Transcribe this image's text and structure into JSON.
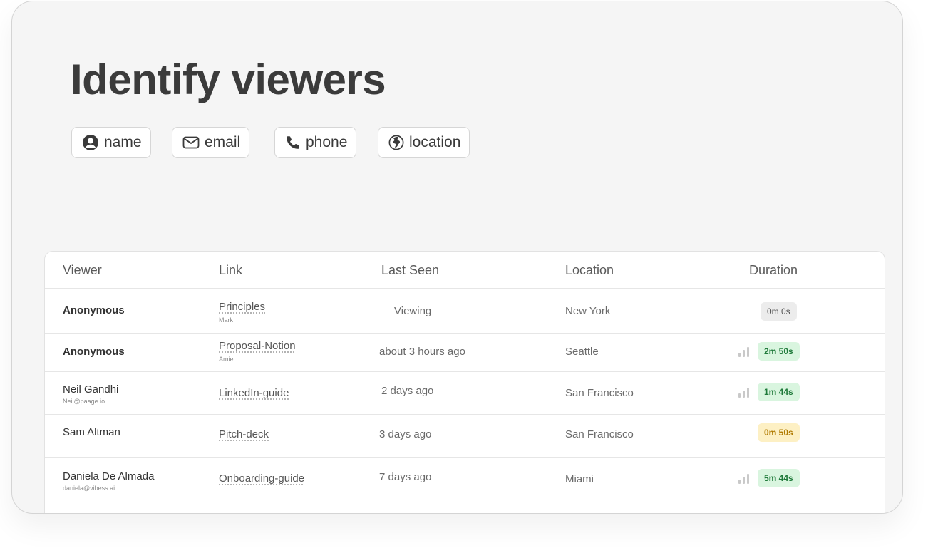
{
  "title": "Identify viewers",
  "chips": [
    {
      "label": "name",
      "icon": "user-circle-icon"
    },
    {
      "label": "email",
      "icon": "envelope-icon"
    },
    {
      "label": "phone",
      "icon": "phone-icon"
    },
    {
      "label": "location",
      "icon": "globe-icon"
    }
  ],
  "table": {
    "headers": {
      "viewer": "Viewer",
      "link": "Link",
      "last_seen": "Last Seen",
      "location": "Location",
      "duration": "Duration"
    },
    "rows": [
      {
        "viewer": "Anonymous",
        "viewer_sub": "",
        "link": "Principles",
        "link_sub": "Mark",
        "last_seen": "Viewing",
        "location": "New York",
        "duration": "0m 0s",
        "duration_style": "neutral",
        "bars_icon": false
      },
      {
        "viewer": "Anonymous",
        "viewer_sub": "",
        "link": "Proposal-Notion",
        "link_sub": "Amie",
        "last_seen": "about 3 hours ago",
        "location": "Seattle",
        "duration": "2m 50s",
        "duration_style": "green",
        "bars_icon": true
      },
      {
        "viewer": "Neil Gandhi",
        "viewer_sub": "Neil@paage.io",
        "link": "LinkedIn-guide",
        "link_sub": "",
        "last_seen": "2 days ago",
        "location": "San Francisco",
        "duration": "1m 44s",
        "duration_style": "green",
        "bars_icon": true
      },
      {
        "viewer": "Sam Altman",
        "viewer_sub": "",
        "link": "Pitch-deck",
        "link_sub": "",
        "last_seen": "3 days ago",
        "location": "San Francisco",
        "duration": "0m 50s",
        "duration_style": "yellow",
        "bars_icon": false
      },
      {
        "viewer": "Daniela De Almada",
        "viewer_sub": "daniela@vibess.ai",
        "link": "Onboarding-guide",
        "link_sub": "",
        "last_seen": "7 days ago",
        "location": "Miami",
        "duration": "5m 44s",
        "duration_style": "green",
        "bars_icon": true
      }
    ]
  },
  "colors": {
    "badge_neutral_bg": "#ececec",
    "badge_neutral_fg": "#555555",
    "badge_green_bg": "#d9f5df",
    "badge_green_fg": "#1f7a3a",
    "badge_yellow_bg": "#fdf0c4",
    "badge_yellow_fg": "#b07a00"
  }
}
